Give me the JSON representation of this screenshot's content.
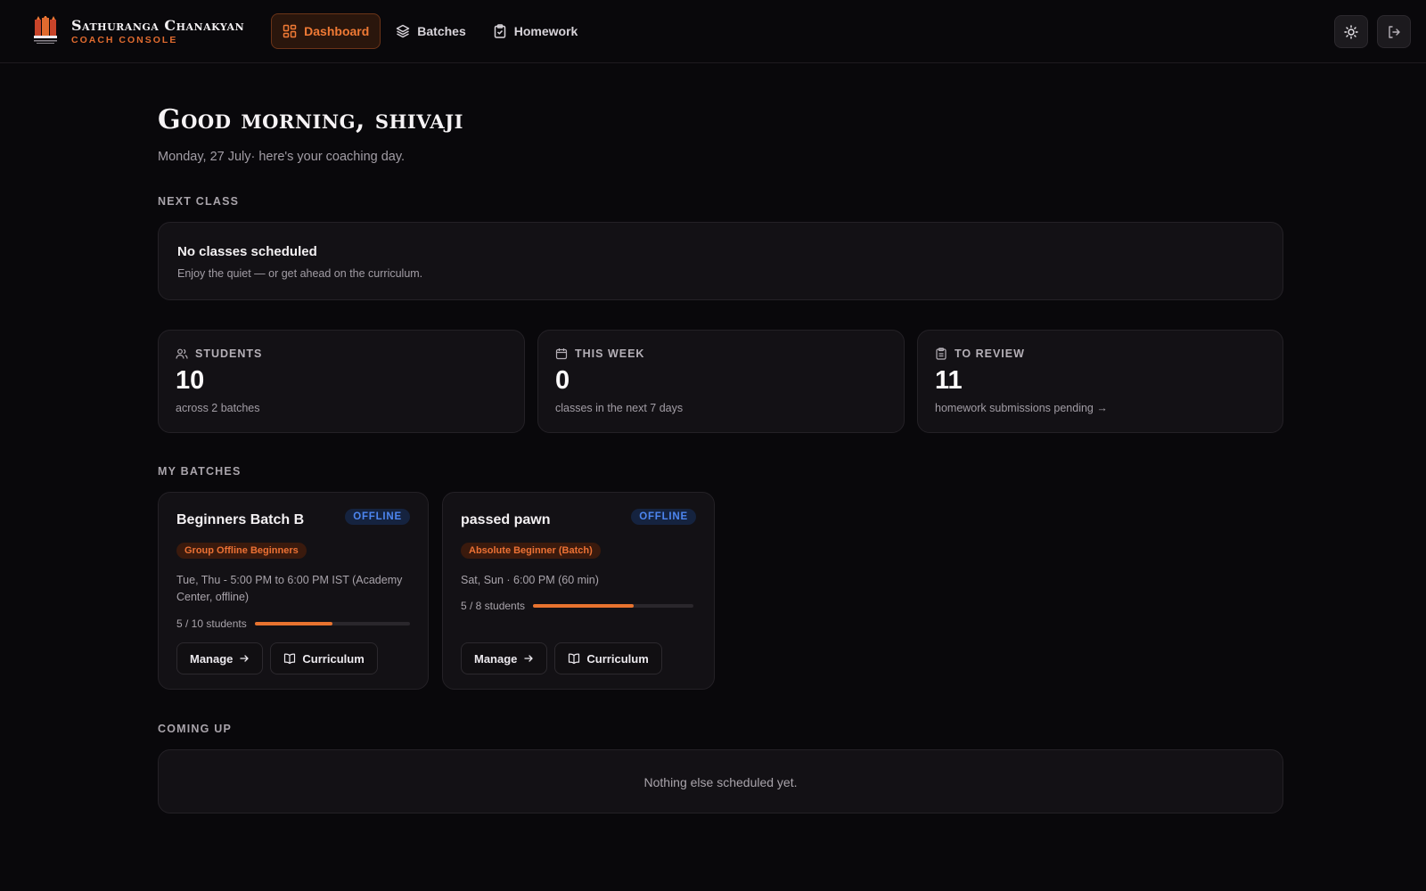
{
  "app": {
    "brand_name": "Sathuranga Chanakyan",
    "brand_sub": "COACH CONSOLE",
    "logo_text": "SATHURANGA CHANAKYAN",
    "accent": "#e8732f"
  },
  "nav": {
    "items": [
      {
        "label": "Dashboard",
        "icon": "grid-icon",
        "active": true
      },
      {
        "label": "Batches",
        "icon": "layers-icon",
        "active": false
      },
      {
        "label": "Homework",
        "icon": "clipboard-check-icon",
        "active": false
      }
    ]
  },
  "actions": {
    "theme_icon": "sun-icon",
    "logout_icon": "logout-icon"
  },
  "greeting": {
    "title": "Good morning, shivaji",
    "subtitle": "Monday, 27 July· here's your coaching day."
  },
  "next_class": {
    "section": "NEXT CLASS",
    "title": "No classes scheduled",
    "desc": "Enjoy the quiet — or get ahead on the curriculum."
  },
  "stats": [
    {
      "label": "STUDENTS",
      "icon": "users-icon",
      "value": "10",
      "sub": "across 2 batches"
    },
    {
      "label": "THIS WEEK",
      "icon": "calendar-icon",
      "value": "0",
      "sub": "classes in the next 7 days"
    },
    {
      "label": "TO REVIEW",
      "icon": "clipboard-icon",
      "value": "11",
      "sub": "homework submissions pending →"
    }
  ],
  "batches": {
    "section": "MY BATCHES",
    "items": [
      {
        "name": "Beginners Batch B",
        "mode": "OFFLINE",
        "level": "Group Offline Beginners",
        "schedule_line1": "Tue, Thu - 5:00 PM to 6:00 PM IST (Academy",
        "schedule_line2": "Center, offline)",
        "capacity": "5 / 10 students",
        "fill": 0.5,
        "manage": "Manage",
        "curriculum": "Curriculum"
      },
      {
        "name": "passed pawn",
        "mode": "OFFLINE",
        "level": "Absolute Beginner (Batch)",
        "schedule_line1": "Sat, Sun · 6:00 PM (60 min)",
        "schedule_line2": "",
        "capacity": "5 / 8 students",
        "fill": 0.625,
        "manage": "Manage",
        "curriculum": "Curriculum"
      }
    ]
  },
  "coming_up": {
    "section": "COMING UP",
    "message": "Nothing else scheduled yet."
  }
}
